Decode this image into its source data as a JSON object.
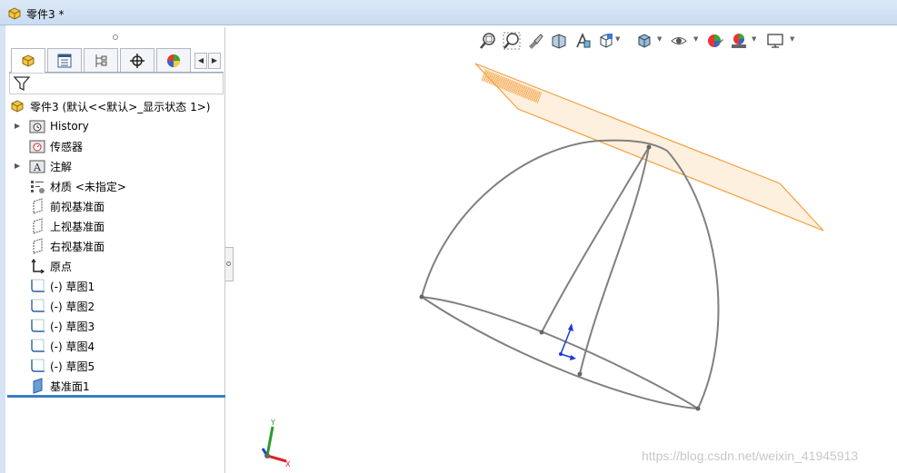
{
  "window": {
    "title": "零件3 *"
  },
  "tabs": [
    "feature-manager",
    "property-manager",
    "configuration-manager",
    "dimxpert-manager",
    "display-manager"
  ],
  "tree": {
    "root": "零件3 (默认<<默认>_显示状态 1>)",
    "items": [
      {
        "label": "History"
      },
      {
        "label": "传感器"
      },
      {
        "label": "注解"
      },
      {
        "label": "材质 <未指定>"
      },
      {
        "label": "前视基准面"
      },
      {
        "label": "上视基准面"
      },
      {
        "label": "右视基准面"
      },
      {
        "label": "原点"
      },
      {
        "label": "(-) 草图1"
      },
      {
        "label": "(-) 草图2"
      },
      {
        "label": "(-) 草图3"
      },
      {
        "label": "(-) 草图4"
      },
      {
        "label": "(-) 草图5"
      },
      {
        "label": "基准面1"
      }
    ]
  },
  "toolbar": {
    "buttons": [
      "zoom-to-fit-icon",
      "zoom-to-area-icon",
      "previous-view-icon",
      "section-view-icon",
      "dynamic-annotation-icon",
      "view-orientation-icon",
      "display-style-icon",
      "hide-show-icon",
      "edit-appearance-icon",
      "apply-scene-icon",
      "view-settings-icon"
    ]
  },
  "triad": {
    "y": "Y",
    "x": "X"
  },
  "watermark": "https://blog.csdn.net/weixin_41945913",
  "colors": {
    "accent": "#3b7fbf",
    "plane": "#f5a040",
    "wireframe": "#808080"
  }
}
